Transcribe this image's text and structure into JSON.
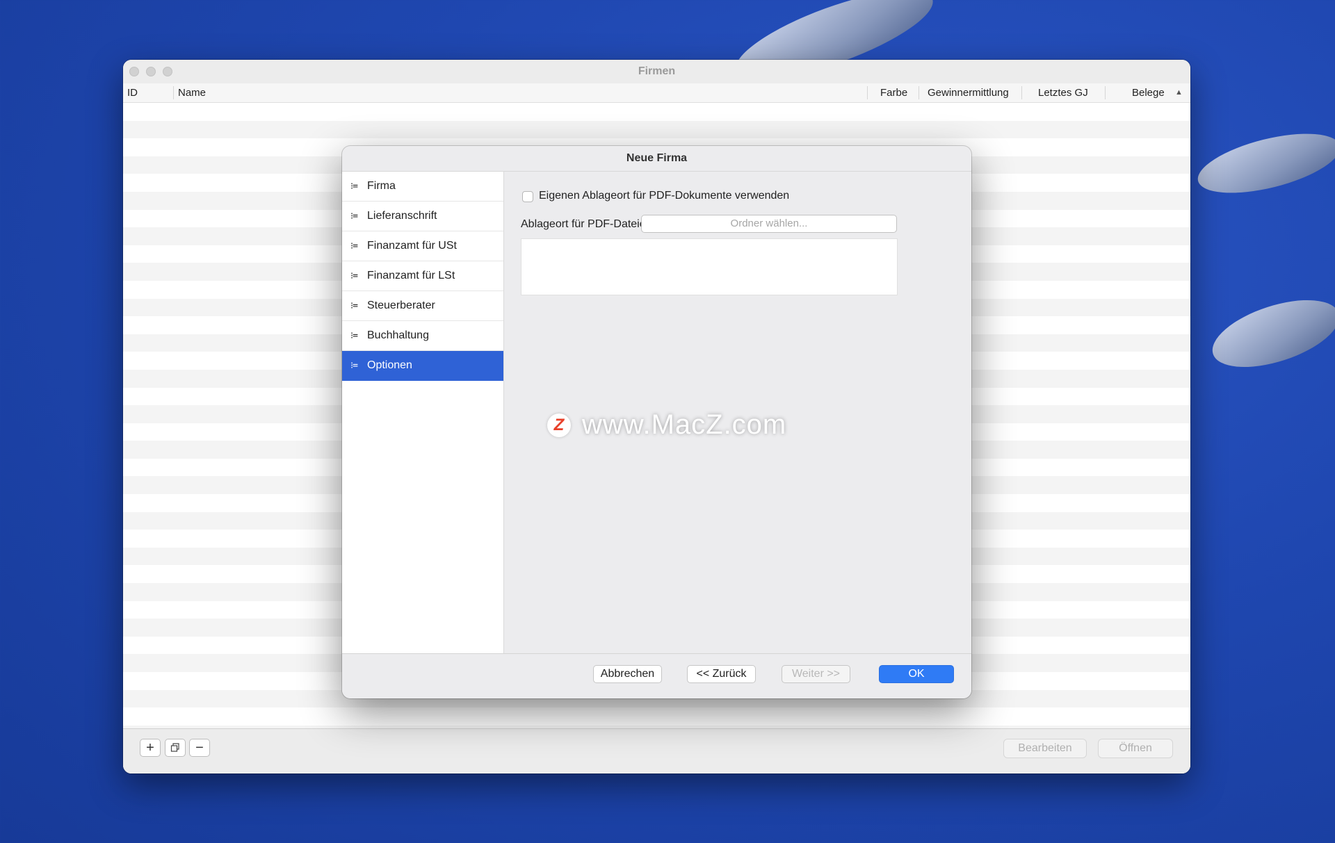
{
  "window": {
    "title": "Firmen",
    "columns": [
      "ID",
      "Name",
      "Farbe",
      "Gewinnermittlung",
      "Letztes GJ",
      "Belege"
    ],
    "sort_icon": "chevron-up-icon",
    "bottom_buttons": {
      "add": "+",
      "duplicate_icon": "copy-icon",
      "remove": "−",
      "edit": "Bearbeiten",
      "open": "Öffnen"
    }
  },
  "dialog": {
    "title": "Neue Firma",
    "sidebar": [
      {
        "label": "Firma",
        "icon": "list-icon",
        "active": false
      },
      {
        "label": "Lieferanschrift",
        "icon": "list-icon",
        "active": false
      },
      {
        "label": "Finanzamt für USt",
        "icon": "list-icon",
        "active": false
      },
      {
        "label": "Finanzamt für LSt",
        "icon": "list-icon",
        "active": false
      },
      {
        "label": "Steuerberater",
        "icon": "list-icon",
        "active": false
      },
      {
        "label": "Buchhaltung",
        "icon": "list-icon",
        "active": false
      },
      {
        "label": "Optionen",
        "icon": "list-icon",
        "active": true
      }
    ],
    "options": {
      "checkbox_label": "Eigenen Ablageort für PDF-Dokumente verwenden",
      "checked": false,
      "path_label": "Ablageort für PDF-Dateien:",
      "path_placeholder": "Ordner wählen..."
    },
    "footer": {
      "cancel": "Abbrechen",
      "back": "<< Zurück",
      "next": "Weiter >>",
      "ok": "OK"
    }
  },
  "watermark": {
    "logo": "Z",
    "text": "www.MacZ.com"
  },
  "colors": {
    "accent": "#2f62d6",
    "primary_button": "#2f7bf5",
    "desktop": "#1f47b0"
  }
}
